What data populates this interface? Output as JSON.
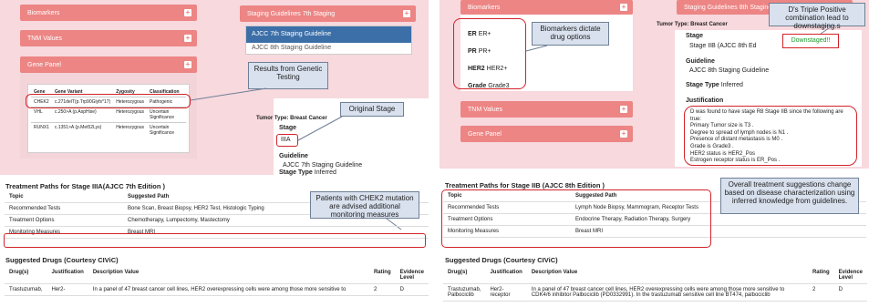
{
  "left_panel": {
    "bars": {
      "biomarkers": "Biomarkers",
      "tnm": "TNM Values",
      "gene_panel": "Gene Panel",
      "staging_7th": "Staging Guidelines 7th Staging"
    },
    "dropdown": {
      "opt1": "AJCC 7th Staging Guideline",
      "opt2": "AJCC 8th Staging Guideline"
    },
    "gene_table": {
      "headers": [
        "Gene",
        "Gene Variant",
        "Zygosity",
        "Classification"
      ],
      "rows": [
        [
          "CHEK2",
          "c.271delT(p.Trp90Glyfs*17)",
          "Heterozygous",
          "Pathogenic"
        ],
        [
          "VHL",
          "c.250>A (p.AspHise)",
          "Heterozygous",
          "Uncertain Significance"
        ],
        [
          "RUNX1",
          "c.1351>A (p.Met52Lys)",
          "Heterozygous",
          "Uncertain Significance"
        ]
      ]
    },
    "tumor": {
      "type": "Tumor Type: Breast Cancer",
      "stage_label": "Stage",
      "stage_value": "IIIA",
      "guideline_label": "Guideline",
      "guideline_value": "AJCC 7th Staging Guideline",
      "stage_type_label": "Stage Type",
      "stage_type_value": "Inferred"
    },
    "callouts": {
      "genetic": "Results from Genetic Testing",
      "original": "Original Stage"
    }
  },
  "right_panel": {
    "bars": {
      "biomarkers": "Biomarkers",
      "tnm": "TNM Values",
      "gene_panel": "Gene Panel",
      "staging_8th": "Staging Guidelines 8th Staging"
    },
    "biomarkers": [
      {
        "k": "ER",
        "v": "ER+"
      },
      {
        "k": "PR",
        "v": "PR+"
      },
      {
        "k": "HER2",
        "v": "HER2+"
      },
      {
        "k": "Grade",
        "v": "Grade3"
      }
    ],
    "tumor": {
      "type": "Tumor Type: Breast Cancer",
      "stage_label": "Stage",
      "stage_value": "Stage IIB (AJCC 8th Ed",
      "guideline_label": "Guideline",
      "guideline_value": "AJCC 8th Staging Guideline",
      "stage_type_label": "Stage Type",
      "stage_type_value": "Inferred",
      "justification_label": "Justification",
      "justification": [
        "D was found to have stage R8 Stage IIB since the following are true:",
        "Primary Tumor size is T3 .",
        "Degree to spread of lymph nodes is N1 .",
        "Presence of distant metastasis is M0 .",
        "Grade is Grade3 .",
        "HER2 status is HER2_Pos",
        "Estrogen receptor status is ER_Pos ."
      ]
    },
    "downstaged": "Downstaged!!",
    "callouts": {
      "biomarkers": "Biomarkers dictate drug options",
      "triple": "D's Triple Positive combination lead to downstaging.s"
    }
  },
  "treatment_left": {
    "title": "Treatment Paths for Stage IIIA(AJCC 7th Edition )",
    "headers": [
      "Topic",
      "Suggested Path"
    ],
    "rows": [
      [
        "Recommended Tests",
        "Bone Scan, Breast Biopsy, HER2 Test, Histologic Typing"
      ],
      [
        "Treatment Options",
        "Chemotherapy, Lumpectomy, Mastectomy"
      ],
      [
        "Monitoring Measures",
        "Breast MRI"
      ]
    ],
    "callout": "Patients with CHEK2 mutation are advised additional monitoring measures"
  },
  "treatment_right": {
    "title": "Treatment Paths for Stage IIB (AJCC 8th Edition )",
    "headers": [
      "Topic",
      "Suggested Path"
    ],
    "rows": [
      [
        "Recommended Tests",
        "Lymph Node Biopsy, Mammogram, Receptor Tests"
      ],
      [
        "Treatment Options",
        "Endocrine Therapy, Radiation Therapy, Surgery"
      ],
      [
        "Monitoring Measures",
        "Breast MRI"
      ]
    ],
    "callout": "Overall treatment suggestions change based on disease characterization using inferred knowledge from guidelines."
  },
  "drugs_left": {
    "title": "Suggested Drugs (Courtesy CIViC)",
    "headers": [
      "Drug(s)",
      "Justification",
      "Description Value",
      "Rating",
      "Evidence Level"
    ],
    "row": [
      "Trastuzumab,",
      "Her2-",
      "In a panel of 47 breast cancer cell lines, HER2 overexpressing cells were among those more sensitive to",
      "2",
      "D"
    ]
  },
  "drugs_right": {
    "title": "Suggested Drugs (Courtesy CIViC)",
    "headers": [
      "Drug(s)",
      "Justification",
      "Description Value",
      "Rating",
      "Evidence Level"
    ],
    "row": [
      "Trastuzumab, Palbociclib",
      "Her2- receptor",
      "In a panel of 47 breast cancer cell lines, HER2 overexpressing cells were among those more sensitive to CDK4/6 inhibitor Palbociclib (PD0332991). In the trastuzumab sensitive cell line BT474, palbociclib",
      "2",
      "D"
    ]
  }
}
